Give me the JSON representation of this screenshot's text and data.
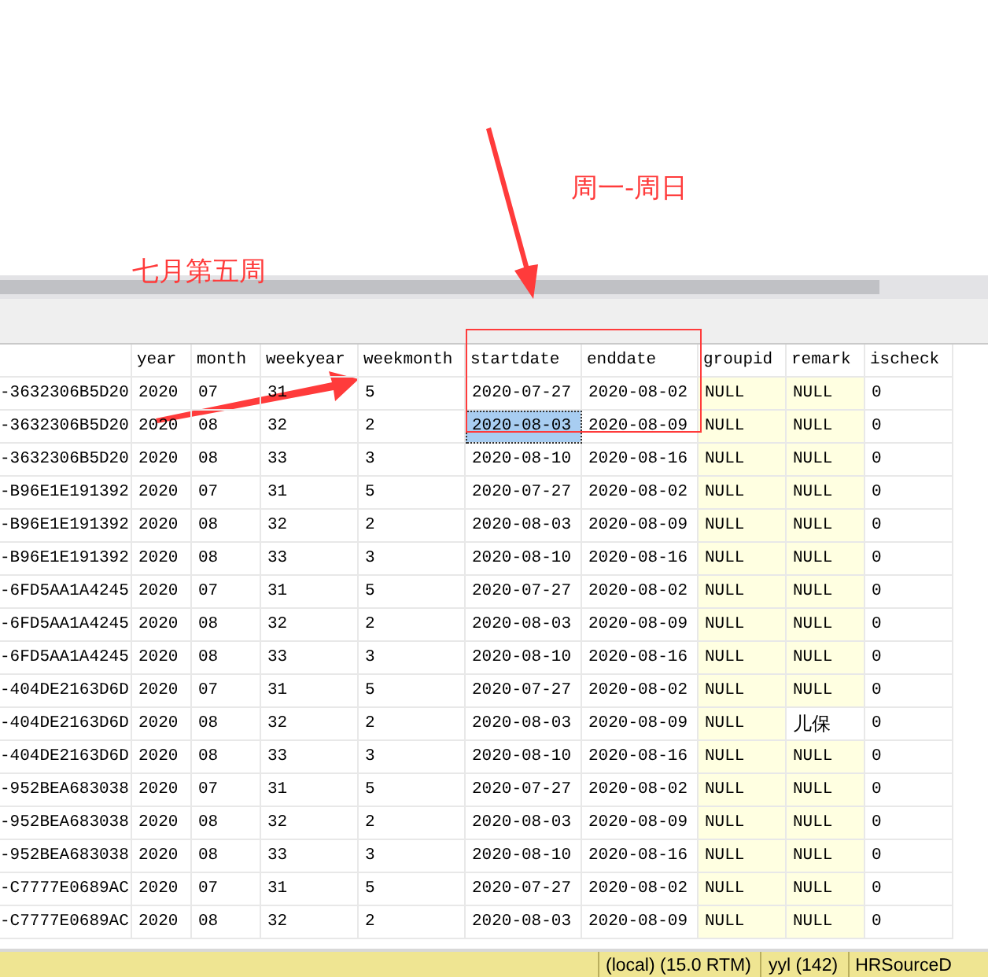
{
  "annotations": [
    {
      "text": "周一-周日"
    },
    {
      "text": "七月第五周"
    }
  ],
  "grid": {
    "columns": [
      "",
      "year",
      "month",
      "weekyear",
      "weekmonth",
      "startdate",
      "enddate",
      "groupid",
      "remark",
      "ischeck"
    ],
    "rows": [
      {
        "cells": [
          {
            "v": "-3632306B5D20",
            "is_null": false,
            "selected": false
          },
          {
            "v": "2020",
            "is_null": false,
            "selected": false
          },
          {
            "v": "07",
            "is_null": false,
            "selected": false
          },
          {
            "v": "31",
            "is_null": false,
            "selected": false
          },
          {
            "v": "5",
            "is_null": false,
            "selected": false
          },
          {
            "v": "2020-07-27",
            "is_null": false,
            "selected": false
          },
          {
            "v": "2020-08-02",
            "is_null": false,
            "selected": false
          },
          {
            "v": "NULL",
            "is_null": true,
            "selected": false
          },
          {
            "v": "NULL",
            "is_null": true,
            "selected": false
          },
          {
            "v": "0",
            "is_null": false,
            "selected": false
          }
        ]
      },
      {
        "cells": [
          {
            "v": "-3632306B5D20",
            "is_null": false,
            "selected": false
          },
          {
            "v": "2020",
            "is_null": false,
            "selected": false
          },
          {
            "v": "08",
            "is_null": false,
            "selected": false
          },
          {
            "v": "32",
            "is_null": false,
            "selected": false
          },
          {
            "v": "2",
            "is_null": false,
            "selected": false
          },
          {
            "v": "2020-08-03",
            "is_null": false,
            "selected": true
          },
          {
            "v": "2020-08-09",
            "is_null": false,
            "selected": false
          },
          {
            "v": "NULL",
            "is_null": true,
            "selected": false
          },
          {
            "v": "NULL",
            "is_null": true,
            "selected": false
          },
          {
            "v": "0",
            "is_null": false,
            "selected": false
          }
        ]
      },
      {
        "cells": [
          {
            "v": "-3632306B5D20",
            "is_null": false,
            "selected": false
          },
          {
            "v": "2020",
            "is_null": false,
            "selected": false
          },
          {
            "v": "08",
            "is_null": false,
            "selected": false
          },
          {
            "v": "33",
            "is_null": false,
            "selected": false
          },
          {
            "v": "3",
            "is_null": false,
            "selected": false
          },
          {
            "v": "2020-08-10",
            "is_null": false,
            "selected": false
          },
          {
            "v": "2020-08-16",
            "is_null": false,
            "selected": false
          },
          {
            "v": "NULL",
            "is_null": true,
            "selected": false
          },
          {
            "v": "NULL",
            "is_null": true,
            "selected": false
          },
          {
            "v": "0",
            "is_null": false,
            "selected": false
          }
        ]
      },
      {
        "cells": [
          {
            "v": "-B96E1E191392",
            "is_null": false,
            "selected": false
          },
          {
            "v": "2020",
            "is_null": false,
            "selected": false
          },
          {
            "v": "07",
            "is_null": false,
            "selected": false
          },
          {
            "v": "31",
            "is_null": false,
            "selected": false
          },
          {
            "v": "5",
            "is_null": false,
            "selected": false
          },
          {
            "v": "2020-07-27",
            "is_null": false,
            "selected": false
          },
          {
            "v": "2020-08-02",
            "is_null": false,
            "selected": false
          },
          {
            "v": "NULL",
            "is_null": true,
            "selected": false
          },
          {
            "v": "NULL",
            "is_null": true,
            "selected": false
          },
          {
            "v": "0",
            "is_null": false,
            "selected": false
          }
        ]
      },
      {
        "cells": [
          {
            "v": "-B96E1E191392",
            "is_null": false,
            "selected": false
          },
          {
            "v": "2020",
            "is_null": false,
            "selected": false
          },
          {
            "v": "08",
            "is_null": false,
            "selected": false
          },
          {
            "v": "32",
            "is_null": false,
            "selected": false
          },
          {
            "v": "2",
            "is_null": false,
            "selected": false
          },
          {
            "v": "2020-08-03",
            "is_null": false,
            "selected": false
          },
          {
            "v": "2020-08-09",
            "is_null": false,
            "selected": false
          },
          {
            "v": "NULL",
            "is_null": true,
            "selected": false
          },
          {
            "v": "NULL",
            "is_null": true,
            "selected": false
          },
          {
            "v": "0",
            "is_null": false,
            "selected": false
          }
        ]
      },
      {
        "cells": [
          {
            "v": "-B96E1E191392",
            "is_null": false,
            "selected": false
          },
          {
            "v": "2020",
            "is_null": false,
            "selected": false
          },
          {
            "v": "08",
            "is_null": false,
            "selected": false
          },
          {
            "v": "33",
            "is_null": false,
            "selected": false
          },
          {
            "v": "3",
            "is_null": false,
            "selected": false
          },
          {
            "v": "2020-08-10",
            "is_null": false,
            "selected": false
          },
          {
            "v": "2020-08-16",
            "is_null": false,
            "selected": false
          },
          {
            "v": "NULL",
            "is_null": true,
            "selected": false
          },
          {
            "v": "NULL",
            "is_null": true,
            "selected": false
          },
          {
            "v": "0",
            "is_null": false,
            "selected": false
          }
        ]
      },
      {
        "cells": [
          {
            "v": "-6FD5AA1A4245",
            "is_null": false,
            "selected": false
          },
          {
            "v": "2020",
            "is_null": false,
            "selected": false
          },
          {
            "v": "07",
            "is_null": false,
            "selected": false
          },
          {
            "v": "31",
            "is_null": false,
            "selected": false
          },
          {
            "v": "5",
            "is_null": false,
            "selected": false
          },
          {
            "v": "2020-07-27",
            "is_null": false,
            "selected": false
          },
          {
            "v": "2020-08-02",
            "is_null": false,
            "selected": false
          },
          {
            "v": "NULL",
            "is_null": true,
            "selected": false
          },
          {
            "v": "NULL",
            "is_null": true,
            "selected": false
          },
          {
            "v": "0",
            "is_null": false,
            "selected": false
          }
        ]
      },
      {
        "cells": [
          {
            "v": "-6FD5AA1A4245",
            "is_null": false,
            "selected": false
          },
          {
            "v": "2020",
            "is_null": false,
            "selected": false
          },
          {
            "v": "08",
            "is_null": false,
            "selected": false
          },
          {
            "v": "32",
            "is_null": false,
            "selected": false
          },
          {
            "v": "2",
            "is_null": false,
            "selected": false
          },
          {
            "v": "2020-08-03",
            "is_null": false,
            "selected": false
          },
          {
            "v": "2020-08-09",
            "is_null": false,
            "selected": false
          },
          {
            "v": "NULL",
            "is_null": true,
            "selected": false
          },
          {
            "v": "NULL",
            "is_null": true,
            "selected": false
          },
          {
            "v": "0",
            "is_null": false,
            "selected": false
          }
        ]
      },
      {
        "cells": [
          {
            "v": "-6FD5AA1A4245",
            "is_null": false,
            "selected": false
          },
          {
            "v": "2020",
            "is_null": false,
            "selected": false
          },
          {
            "v": "08",
            "is_null": false,
            "selected": false
          },
          {
            "v": "33",
            "is_null": false,
            "selected": false
          },
          {
            "v": "3",
            "is_null": false,
            "selected": false
          },
          {
            "v": "2020-08-10",
            "is_null": false,
            "selected": false
          },
          {
            "v": "2020-08-16",
            "is_null": false,
            "selected": false
          },
          {
            "v": "NULL",
            "is_null": true,
            "selected": false
          },
          {
            "v": "NULL",
            "is_null": true,
            "selected": false
          },
          {
            "v": "0",
            "is_null": false,
            "selected": false
          }
        ]
      },
      {
        "cells": [
          {
            "v": "-404DE2163D6D",
            "is_null": false,
            "selected": false
          },
          {
            "v": "2020",
            "is_null": false,
            "selected": false
          },
          {
            "v": "07",
            "is_null": false,
            "selected": false
          },
          {
            "v": "31",
            "is_null": false,
            "selected": false
          },
          {
            "v": "5",
            "is_null": false,
            "selected": false
          },
          {
            "v": "2020-07-27",
            "is_null": false,
            "selected": false
          },
          {
            "v": "2020-08-02",
            "is_null": false,
            "selected": false
          },
          {
            "v": "NULL",
            "is_null": true,
            "selected": false
          },
          {
            "v": "NULL",
            "is_null": true,
            "selected": false
          },
          {
            "v": "0",
            "is_null": false,
            "selected": false
          }
        ]
      },
      {
        "cells": [
          {
            "v": "-404DE2163D6D",
            "is_null": false,
            "selected": false
          },
          {
            "v": "2020",
            "is_null": false,
            "selected": false
          },
          {
            "v": "08",
            "is_null": false,
            "selected": false
          },
          {
            "v": "32",
            "is_null": false,
            "selected": false
          },
          {
            "v": "2",
            "is_null": false,
            "selected": false
          },
          {
            "v": "2020-08-03",
            "is_null": false,
            "selected": false
          },
          {
            "v": "2020-08-09",
            "is_null": false,
            "selected": false
          },
          {
            "v": "NULL",
            "is_null": true,
            "selected": false
          },
          {
            "v": "儿保",
            "is_null": false,
            "selected": false
          },
          {
            "v": "0",
            "is_null": false,
            "selected": false
          }
        ]
      },
      {
        "cells": [
          {
            "v": "-404DE2163D6D",
            "is_null": false,
            "selected": false
          },
          {
            "v": "2020",
            "is_null": false,
            "selected": false
          },
          {
            "v": "08",
            "is_null": false,
            "selected": false
          },
          {
            "v": "33",
            "is_null": false,
            "selected": false
          },
          {
            "v": "3",
            "is_null": false,
            "selected": false
          },
          {
            "v": "2020-08-10",
            "is_null": false,
            "selected": false
          },
          {
            "v": "2020-08-16",
            "is_null": false,
            "selected": false
          },
          {
            "v": "NULL",
            "is_null": true,
            "selected": false
          },
          {
            "v": "NULL",
            "is_null": true,
            "selected": false
          },
          {
            "v": "0",
            "is_null": false,
            "selected": false
          }
        ]
      },
      {
        "cells": [
          {
            "v": "-952BEA683038",
            "is_null": false,
            "selected": false
          },
          {
            "v": "2020",
            "is_null": false,
            "selected": false
          },
          {
            "v": "07",
            "is_null": false,
            "selected": false
          },
          {
            "v": "31",
            "is_null": false,
            "selected": false
          },
          {
            "v": "5",
            "is_null": false,
            "selected": false
          },
          {
            "v": "2020-07-27",
            "is_null": false,
            "selected": false
          },
          {
            "v": "2020-08-02",
            "is_null": false,
            "selected": false
          },
          {
            "v": "NULL",
            "is_null": true,
            "selected": false
          },
          {
            "v": "NULL",
            "is_null": true,
            "selected": false
          },
          {
            "v": "0",
            "is_null": false,
            "selected": false
          }
        ]
      },
      {
        "cells": [
          {
            "v": "-952BEA683038",
            "is_null": false,
            "selected": false
          },
          {
            "v": "2020",
            "is_null": false,
            "selected": false
          },
          {
            "v": "08",
            "is_null": false,
            "selected": false
          },
          {
            "v": "32",
            "is_null": false,
            "selected": false
          },
          {
            "v": "2",
            "is_null": false,
            "selected": false
          },
          {
            "v": "2020-08-03",
            "is_null": false,
            "selected": false
          },
          {
            "v": "2020-08-09",
            "is_null": false,
            "selected": false
          },
          {
            "v": "NULL",
            "is_null": true,
            "selected": false
          },
          {
            "v": "NULL",
            "is_null": true,
            "selected": false
          },
          {
            "v": "0",
            "is_null": false,
            "selected": false
          }
        ]
      },
      {
        "cells": [
          {
            "v": "-952BEA683038",
            "is_null": false,
            "selected": false
          },
          {
            "v": "2020",
            "is_null": false,
            "selected": false
          },
          {
            "v": "08",
            "is_null": false,
            "selected": false
          },
          {
            "v": "33",
            "is_null": false,
            "selected": false
          },
          {
            "v": "3",
            "is_null": false,
            "selected": false
          },
          {
            "v": "2020-08-10",
            "is_null": false,
            "selected": false
          },
          {
            "v": "2020-08-16",
            "is_null": false,
            "selected": false
          },
          {
            "v": "NULL",
            "is_null": true,
            "selected": false
          },
          {
            "v": "NULL",
            "is_null": true,
            "selected": false
          },
          {
            "v": "0",
            "is_null": false,
            "selected": false
          }
        ]
      },
      {
        "cells": [
          {
            "v": "-C7777E0689AC",
            "is_null": false,
            "selected": false
          },
          {
            "v": "2020",
            "is_null": false,
            "selected": false
          },
          {
            "v": "07",
            "is_null": false,
            "selected": false
          },
          {
            "v": "31",
            "is_null": false,
            "selected": false
          },
          {
            "v": "5",
            "is_null": false,
            "selected": false
          },
          {
            "v": "2020-07-27",
            "is_null": false,
            "selected": false
          },
          {
            "v": "2020-08-02",
            "is_null": false,
            "selected": false
          },
          {
            "v": "NULL",
            "is_null": true,
            "selected": false
          },
          {
            "v": "NULL",
            "is_null": true,
            "selected": false
          },
          {
            "v": "0",
            "is_null": false,
            "selected": false
          }
        ]
      },
      {
        "cells": [
          {
            "v": "-C7777E0689AC",
            "is_null": false,
            "selected": false
          },
          {
            "v": "2020",
            "is_null": false,
            "selected": false
          },
          {
            "v": "08",
            "is_null": false,
            "selected": false
          },
          {
            "v": "32",
            "is_null": false,
            "selected": false
          },
          {
            "v": "2",
            "is_null": false,
            "selected": false
          },
          {
            "v": "2020-08-03",
            "is_null": false,
            "selected": false
          },
          {
            "v": "2020-08-09",
            "is_null": false,
            "selected": false
          },
          {
            "v": "NULL",
            "is_null": true,
            "selected": false
          },
          {
            "v": "NULL",
            "is_null": true,
            "selected": false
          },
          {
            "v": "0",
            "is_null": false,
            "selected": false
          }
        ]
      }
    ]
  },
  "status_bar": {
    "items": [
      "(local) (15.0 RTM)",
      "yyl (142)",
      "HRSourceD"
    ]
  }
}
